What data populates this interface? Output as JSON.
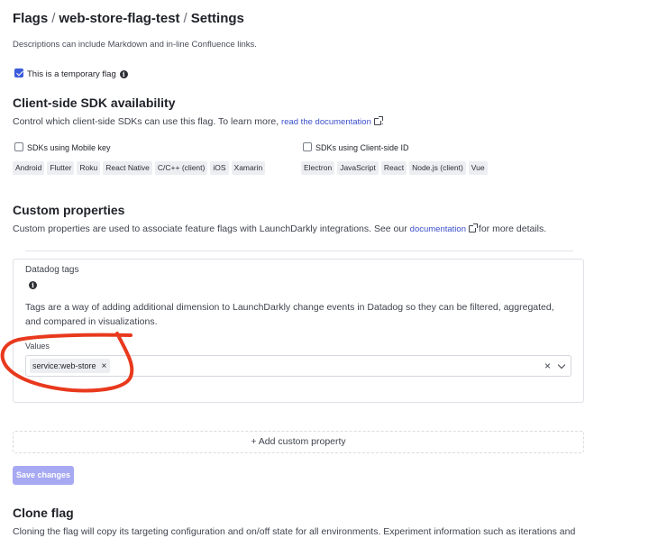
{
  "breadcrumb": {
    "root": "Flags",
    "flag": "web-store-flag-test",
    "current": "Settings",
    "separator": "/"
  },
  "description_hint": "Descriptions can include Markdown and in-line Confluence links.",
  "temporary_flag": {
    "label": "This is a temporary flag",
    "checked": true
  },
  "sdk_section": {
    "title": "Client-side SDK availability",
    "text": "Control which client-side SDKs can use this flag. To learn more,",
    "link": "read the documentation",
    "text_end": ".",
    "mobile": {
      "label": "SDKs using Mobile key",
      "checked": false,
      "sdks": [
        "Android",
        "Flutter",
        "Roku",
        "React Native",
        "C/C++ (client)",
        "iOS",
        "Xamarin"
      ]
    },
    "client": {
      "label": "SDKs using Client-side ID",
      "checked": false,
      "sdks": [
        "Electron",
        "JavaScript",
        "React",
        "Node.js (client)",
        "Vue"
      ]
    }
  },
  "custom_properties": {
    "title": "Custom properties",
    "text": "Custom properties are used to associate feature flags with LaunchDarkly integrations. See our",
    "link": "documentation",
    "text_end": "for more details.",
    "panel": {
      "name": "Datadog tags",
      "description_line1": "Tags are a way of adding additional dimension to LaunchDarkly change events in Datadog so they can be filtered, aggregated,",
      "description_line2": "and compared in visualizations.",
      "values_label": "Values",
      "values": [
        "service:web-store"
      ]
    },
    "add_label": "+ Add custom property"
  },
  "save_button": "Save changes",
  "clone_section": {
    "title": "Clone flag",
    "text": "Cloning the flag will copy its targeting configuration and on/off state for all environments. Experiment information such as iterations and"
  },
  "colors": {
    "accent": "#3b4fc9",
    "save_button_bg": "#a7a9f2",
    "annotation": "#e8391d"
  }
}
